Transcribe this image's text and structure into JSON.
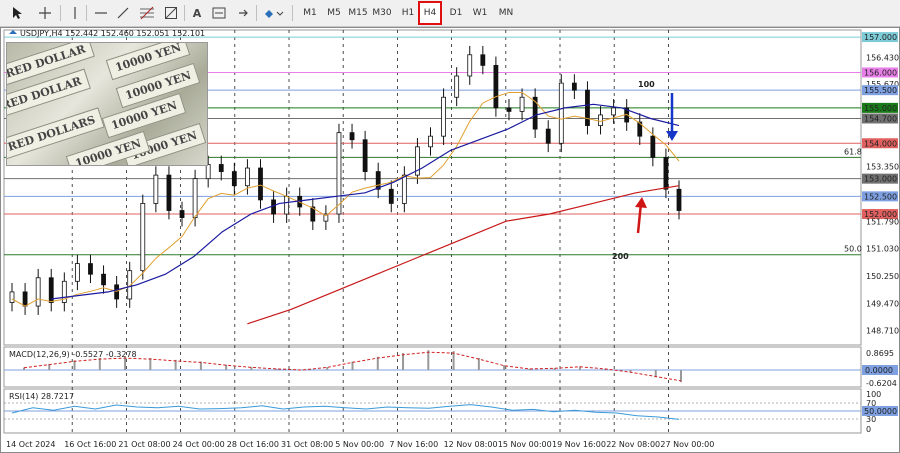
{
  "toolbar": {
    "drawing_tools": [
      "cursor-icon",
      "crosshair-icon",
      "vertical-line-icon",
      "horizontal-line-icon",
      "trendline-icon",
      "fibonacci-icon",
      "channel-icon",
      "text-icon",
      "label-icon",
      "arrow-icon"
    ],
    "text_tool_label": "A",
    "timeframes": [
      "M1",
      "M5",
      "M15",
      "M30",
      "H1",
      "H4",
      "D1",
      "W1",
      "MN"
    ],
    "active_timeframe": "H4"
  },
  "chart_header": {
    "symbol_info": "USDJPY,H4  152.442 152.460 152.051 152.101"
  },
  "annotations": {
    "label_100": "100",
    "label_200": "200",
    "fib_618": "61.8",
    "fib_500": "50.0",
    "color_100": "#1535c8",
    "color_200": "#d01515"
  },
  "thumbnail": {
    "notes": [
      "10000 YEN",
      "10000 YEN",
      "10000 YEN",
      "10000 YEN",
      "RED DOLLAR",
      "RED DOLLAR",
      "RED DOLLARS",
      "10000 YEN"
    ]
  },
  "indicators": {
    "macd_label": "MACD(12,26,9) -0.5527 -0.3278",
    "rsi_label": "RSI(14) 28.7217"
  },
  "chart_data": [
    {
      "type": "line",
      "title": "USDJPY,H4",
      "x": [
        "14 Oct 2024",
        "16 Oct 16:00",
        "21 Oct 08:00",
        "24 Oct 00:00",
        "28 Oct 16:00",
        "31 Oct 08:00",
        "5 Nov 00:00",
        "7 Nov 16:00",
        "12 Nov 08:00",
        "15 Nov 00:00",
        "19 Nov 16:00",
        "22 Nov 08:00",
        "27 Nov 00:00"
      ],
      "ylim": [
        148.3,
        157.2
      ],
      "y_ticks": [
        "157.000",
        "156.430",
        "156.000",
        "155.670",
        "155.500",
        "155.000",
        "154.700",
        "154.000",
        "153.350",
        "153.000",
        "152.500",
        "152.000",
        "151.790",
        "151.030",
        "150.250",
        "149.470",
        "148.710"
      ],
      "highlighted_levels": [
        {
          "value": 157.0,
          "label": "157.000",
          "color": "#7ecbd8"
        },
        {
          "value": 156.0,
          "label": "156.000",
          "color": "#e87ee8"
        },
        {
          "value": 155.5,
          "label": "155.500",
          "color": "#7e9fe0"
        },
        {
          "value": 155.0,
          "label": "155.000",
          "color": "#1a7a1a"
        },
        {
          "value": 154.0,
          "label": "154.000",
          "color": "#e06060"
        },
        {
          "value": 153.0,
          "label": "153.000",
          "color": "#707070"
        },
        {
          "value": 152.5,
          "label": "152.500",
          "color": "#7e9fe0"
        },
        {
          "value": 152.0,
          "label": "152.000",
          "color": "#e06060"
        },
        {
          "value": 154.7,
          "label": "154.700",
          "color": "#707070"
        }
      ],
      "series": [
        {
          "values": [
            149.8,
            149.4,
            150.2,
            149.5,
            150.1,
            150.6,
            150.3,
            150.0,
            149.6,
            150.4,
            152.3,
            153.1,
            152.1,
            151.9,
            153.0,
            153.4,
            153.2,
            152.8,
            153.3,
            152.4,
            152.0,
            152.5,
            152.2,
            151.8,
            152.0,
            154.3,
            154.1,
            153.2,
            152.7,
            152.3,
            153.1,
            153.9,
            154.2,
            155.3,
            155.9,
            156.5,
            156.2,
            155.0,
            154.9,
            155.3,
            154.4,
            154.0,
            155.7,
            155.5,
            154.5,
            154.8,
            155.0,
            154.6,
            154.2,
            153.6,
            152.7,
            152.1
          ]
        },
        {
          "name": "100",
          "values": [
            149.6,
            149.7,
            149.8,
            150.0,
            150.3,
            150.8,
            151.5,
            152.0,
            152.3,
            152.4,
            152.5,
            152.6,
            152.9,
            153.3,
            153.8,
            154.1,
            154.4,
            154.8,
            155.0,
            155.1,
            155.0,
            154.7,
            154.5
          ]
        },
        {
          "name": "200",
          "values": [
            148.9,
            149.3,
            149.8,
            150.3,
            150.8,
            151.3,
            151.8,
            152.0,
            152.3,
            152.6,
            152.8
          ]
        }
      ]
    },
    {
      "type": "bar",
      "title": "MACD(12,26,9) -0.5527 -0.3278",
      "y_ticks": [
        "0.8695",
        "0.0000",
        "-0.6204"
      ],
      "ylim": [
        -0.62,
        0.87
      ],
      "values": [
        0.1,
        0.25,
        0.4,
        0.5,
        0.55,
        0.5,
        0.42,
        0.35,
        0.22,
        0.12,
        0.05,
        0.0,
        0.12,
        0.35,
        0.55,
        0.7,
        0.82,
        0.78,
        0.5,
        0.2,
        0.05,
        0.08,
        0.15,
        0.05,
        -0.1,
        -0.3,
        -0.5
      ]
    },
    {
      "type": "line",
      "title": "RSI(14) 28.7217",
      "y_ticks": [
        "100",
        "70",
        "50.0000",
        "30",
        "0"
      ],
      "ylim": [
        0,
        100
      ],
      "values": [
        45,
        58,
        52,
        62,
        55,
        65,
        60,
        58,
        62,
        55,
        56,
        58,
        63,
        55,
        60,
        62,
        58,
        55,
        60,
        58,
        57,
        62,
        66,
        60,
        52,
        54,
        48,
        52,
        47,
        45,
        38,
        35,
        29
      ]
    }
  ]
}
